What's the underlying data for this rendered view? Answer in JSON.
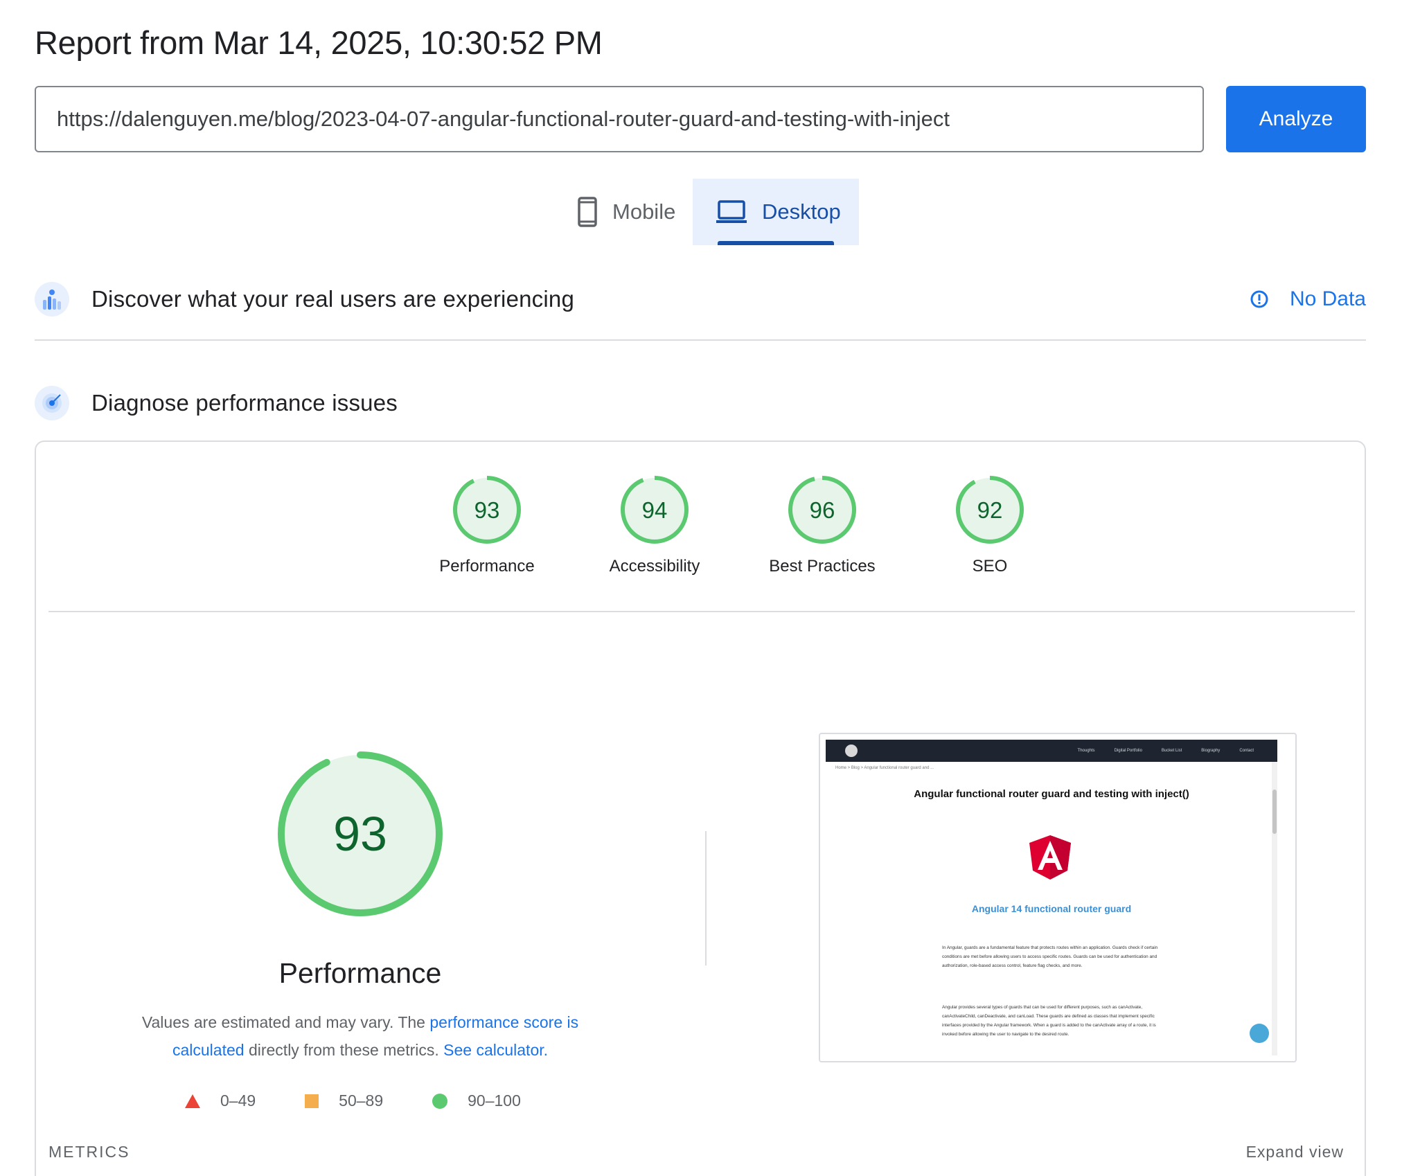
{
  "report": {
    "title": "Report from Mar 14, 2025, 10:30:52 PM"
  },
  "search": {
    "url": "https://dalenguyen.me/blog/2023-04-07-angular-functional-router-guard-and-testing-with-inject",
    "analyze_label": "Analyze"
  },
  "device_tabs": [
    {
      "label": "Mobile",
      "icon": "mobile-phone-icon",
      "selected": false
    },
    {
      "label": "Desktop",
      "icon": "laptop-icon",
      "selected": true
    }
  ],
  "crux": {
    "title": "Discover what your real users are experiencing",
    "status": "No Data",
    "icon": "users-chart-icon"
  },
  "diagnose": {
    "title": "Diagnose performance issues",
    "icon": "lighthouse-radar-icon",
    "categories": [
      {
        "label": "Performance",
        "score": 93
      },
      {
        "label": "Accessibility",
        "score": 94
      },
      {
        "label": "Best Practices",
        "score": 96
      },
      {
        "label": "SEO",
        "score": 92
      }
    ]
  },
  "performance": {
    "score": 93,
    "title": "Performance",
    "desc_prefix": "Values are estimated and may vary. The ",
    "desc_link1": "performance score is calculated",
    "desc_middle": " directly from these metrics. ",
    "desc_link2": "See calculator.",
    "legend": [
      {
        "label": "0–49",
        "shape": "triangle",
        "color": "#eb4335"
      },
      {
        "label": "50–89",
        "shape": "square",
        "color": "#f5ae4d"
      },
      {
        "label": "90–100",
        "shape": "circle",
        "color": "#5bc96f"
      }
    ]
  },
  "screenshot": {
    "nav_items": [
      "Thoughts",
      "Digital Portfolio",
      "Bucket List",
      "Biography",
      "Contact"
    ],
    "breadcrumb": "Home  >  Blog  >  Angular functional router guard and ...",
    "heading": "Angular functional router guard and testing with inject()",
    "subheading": "Angular 14 functional router guard",
    "para1": "In Angular, guards are a fundamental feature that protects routes within an application. Guards check if certain conditions are met before allowing users to access specific routes. Guards can be used for authentication and authorization, role-based access control, feature flag checks, and more.",
    "para2": "Angular provides several types of guards that can be used for different purposes, such as canActivate, canActivateChild, canDeactivate, and canLoad. These guards are defined as classes that implement specific interfaces provided by the Angular framework. When a guard is added to the canActivate array of a route, it is invoked before allowing the user to navigate to the desired route."
  },
  "metrics": {
    "label": "METRICS",
    "expand_label": "Expand view"
  },
  "colors": {
    "accent": "#1a73e8",
    "pass_green": "#5bc96f",
    "pass_fill": "#e6f4ea",
    "pass_text": "#0d652d"
  }
}
